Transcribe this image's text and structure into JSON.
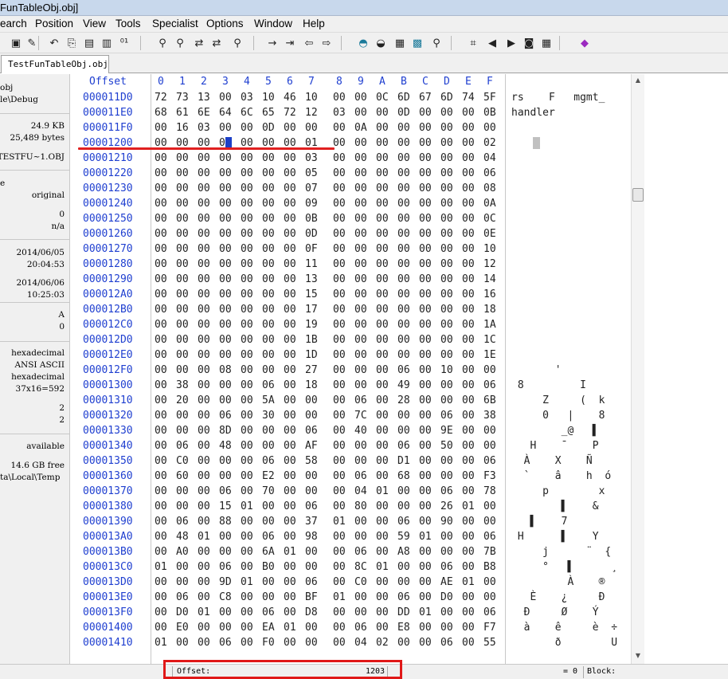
{
  "window": {
    "title": "FunTableObj.obj]"
  },
  "menu": [
    "earch",
    "Position",
    "View",
    "Tools",
    "Specialist",
    "Options",
    "Window",
    "Help"
  ],
  "toolbar_icons": [
    "save-icon",
    "edit-icon",
    "undo-icon",
    "copy-icon",
    "paste-icon",
    "clipboard-icon",
    "binary-icon",
    "find-icon",
    "find-hex-icon",
    "replace-icon",
    "replace-hex-icon",
    "find-text-icon",
    "goto-icon",
    "goto-offset-icon",
    "back-icon",
    "forward-icon",
    "disk-icon",
    "disk-open-icon",
    "ram-icon",
    "calculator-icon",
    "search-icon",
    "block-icon",
    "prev-icon",
    "next-icon",
    "camera-icon",
    "table-icon",
    "book-icon"
  ],
  "tab": {
    "label": "TestFunTableObj.obj"
  },
  "info": {
    "lines": [
      {
        "text": "obj",
        "align": "l"
      },
      {
        "text": "le\\Debug",
        "align": "l"
      },
      {
        "text": "24.9 KB",
        "align": "r"
      },
      {
        "text": "25,489 bytes",
        "align": "r"
      },
      {
        "text": "TESTFU~1.OBJ",
        "align": "r"
      },
      {
        "text": "e",
        "align": "l"
      },
      {
        "text": "original",
        "align": "r"
      },
      {
        "text": "0",
        "align": "r"
      },
      {
        "text": "n/a",
        "align": "r"
      },
      {
        "text": "2014/06/05",
        "align": "r"
      },
      {
        "text": "20:04:53",
        "align": "r"
      },
      {
        "text": "2014/06/06",
        "align": "r"
      },
      {
        "text": "10:25:03",
        "align": "r"
      },
      {
        "text": "A",
        "align": "r"
      },
      {
        "text": "0",
        "align": "r"
      },
      {
        "text": "hexadecimal",
        "align": "r"
      },
      {
        "text": "ANSI ASCII",
        "align": "r"
      },
      {
        "text": "hexadecimal",
        "align": "r"
      },
      {
        "text": "37x16=592",
        "align": "r"
      },
      {
        "text": "2",
        "align": "r"
      },
      {
        "text": "2",
        "align": "r"
      },
      {
        "text": "available",
        "align": "r"
      },
      {
        "text": "14.6 GB free",
        "align": "r"
      },
      {
        "text": "ta\\Local\\Temp",
        "align": "l"
      }
    ]
  },
  "hex": {
    "offset_header": "Offset",
    "column_headers": [
      "0",
      "1",
      "2",
      "3",
      "4",
      "5",
      "6",
      "7",
      "8",
      "9",
      "A",
      "B",
      "C",
      "D",
      "E",
      "F"
    ],
    "cursor": {
      "row": 5,
      "col": 3
    },
    "rows": [
      {
        "offset": "000011D0",
        "bytes": [
          "72",
          "73",
          "13",
          "00",
          "03",
          "10",
          "46",
          "10",
          "00",
          "00",
          "0C",
          "6D",
          "67",
          "6D",
          "74",
          "5F"
        ],
        "text": "rs    F   mgmt_"
      },
      {
        "offset": "000011E0",
        "bytes": [
          "68",
          "61",
          "6E",
          "64",
          "6C",
          "65",
          "72",
          "12",
          "03",
          "00",
          "00",
          "0D",
          "00",
          "00",
          "00",
          "0B"
        ],
        "text": "handler"
      },
      {
        "offset": "000011F0",
        "bytes": [
          "00",
          "16",
          "03",
          "00",
          "00",
          "0D",
          "00",
          "00",
          "00",
          "0A",
          "00",
          "00",
          "00",
          "00",
          "00",
          "00"
        ],
        "text": ""
      },
      {
        "offset": "00001200",
        "bytes": [
          "00",
          "00",
          "00",
          "00",
          "00",
          "00",
          "00",
          "01",
          "00",
          "00",
          "00",
          "00",
          "00",
          "00",
          "00",
          "02"
        ],
        "text": ""
      },
      {
        "offset": "00001210",
        "bytes": [
          "00",
          "00",
          "00",
          "00",
          "00",
          "00",
          "00",
          "03",
          "00",
          "00",
          "00",
          "00",
          "00",
          "00",
          "00",
          "04"
        ],
        "text": ""
      },
      {
        "offset": "00001220",
        "bytes": [
          "00",
          "00",
          "00",
          "00",
          "00",
          "00",
          "00",
          "05",
          "00",
          "00",
          "00",
          "00",
          "00",
          "00",
          "00",
          "06"
        ],
        "text": ""
      },
      {
        "offset": "00001230",
        "bytes": [
          "00",
          "00",
          "00",
          "00",
          "00",
          "00",
          "00",
          "07",
          "00",
          "00",
          "00",
          "00",
          "00",
          "00",
          "00",
          "08"
        ],
        "text": ""
      },
      {
        "offset": "00001240",
        "bytes": [
          "00",
          "00",
          "00",
          "00",
          "00",
          "00",
          "00",
          "09",
          "00",
          "00",
          "00",
          "00",
          "00",
          "00",
          "00",
          "0A"
        ],
        "text": ""
      },
      {
        "offset": "00001250",
        "bytes": [
          "00",
          "00",
          "00",
          "00",
          "00",
          "00",
          "00",
          "0B",
          "00",
          "00",
          "00",
          "00",
          "00",
          "00",
          "00",
          "0C"
        ],
        "text": ""
      },
      {
        "offset": "00001260",
        "bytes": [
          "00",
          "00",
          "00",
          "00",
          "00",
          "00",
          "00",
          "0D",
          "00",
          "00",
          "00",
          "00",
          "00",
          "00",
          "00",
          "0E"
        ],
        "text": ""
      },
      {
        "offset": "00001270",
        "bytes": [
          "00",
          "00",
          "00",
          "00",
          "00",
          "00",
          "00",
          "0F",
          "00",
          "00",
          "00",
          "00",
          "00",
          "00",
          "00",
          "10"
        ],
        "text": ""
      },
      {
        "offset": "00001280",
        "bytes": [
          "00",
          "00",
          "00",
          "00",
          "00",
          "00",
          "00",
          "11",
          "00",
          "00",
          "00",
          "00",
          "00",
          "00",
          "00",
          "12"
        ],
        "text": ""
      },
      {
        "offset": "00001290",
        "bytes": [
          "00",
          "00",
          "00",
          "00",
          "00",
          "00",
          "00",
          "13",
          "00",
          "00",
          "00",
          "00",
          "00",
          "00",
          "00",
          "14"
        ],
        "text": ""
      },
      {
        "offset": "000012A0",
        "bytes": [
          "00",
          "00",
          "00",
          "00",
          "00",
          "00",
          "00",
          "15",
          "00",
          "00",
          "00",
          "00",
          "00",
          "00",
          "00",
          "16"
        ],
        "text": ""
      },
      {
        "offset": "000012B0",
        "bytes": [
          "00",
          "00",
          "00",
          "00",
          "00",
          "00",
          "00",
          "17",
          "00",
          "00",
          "00",
          "00",
          "00",
          "00",
          "00",
          "18"
        ],
        "text": ""
      },
      {
        "offset": "000012C0",
        "bytes": [
          "00",
          "00",
          "00",
          "00",
          "00",
          "00",
          "00",
          "19",
          "00",
          "00",
          "00",
          "00",
          "00",
          "00",
          "00",
          "1A"
        ],
        "text": ""
      },
      {
        "offset": "000012D0",
        "bytes": [
          "00",
          "00",
          "00",
          "00",
          "00",
          "00",
          "00",
          "1B",
          "00",
          "00",
          "00",
          "00",
          "00",
          "00",
          "00",
          "1C"
        ],
        "text": ""
      },
      {
        "offset": "000012E0",
        "bytes": [
          "00",
          "00",
          "00",
          "00",
          "00",
          "00",
          "00",
          "1D",
          "00",
          "00",
          "00",
          "00",
          "00",
          "00",
          "00",
          "1E"
        ],
        "text": ""
      },
      {
        "offset": "000012F0",
        "bytes": [
          "00",
          "00",
          "00",
          "08",
          "00",
          "00",
          "00",
          "27",
          "00",
          "00",
          "00",
          "06",
          "00",
          "10",
          "00",
          "00"
        ],
        "text": "       '"
      },
      {
        "offset": "00001300",
        "bytes": [
          "00",
          "38",
          "00",
          "00",
          "00",
          "06",
          "00",
          "18",
          "00",
          "00",
          "00",
          "49",
          "00",
          "00",
          "00",
          "06"
        ],
        "text": " 8         I"
      },
      {
        "offset": "00001310",
        "bytes": [
          "00",
          "20",
          "00",
          "00",
          "00",
          "5A",
          "00",
          "00",
          "00",
          "06",
          "00",
          "28",
          "00",
          "00",
          "00",
          "6B"
        ],
        "text": "     Z     (  k"
      },
      {
        "offset": "00001320",
        "bytes": [
          "00",
          "00",
          "00",
          "06",
          "00",
          "30",
          "00",
          "00",
          "00",
          "7C",
          "00",
          "00",
          "00",
          "06",
          "00",
          "38"
        ],
        "text": "     0   |    8"
      },
      {
        "offset": "00001330",
        "bytes": [
          "00",
          "00",
          "00",
          "8D",
          "00",
          "00",
          "00",
          "06",
          "00",
          "40",
          "00",
          "00",
          "00",
          "9E",
          "00",
          "00"
        ],
        "text": "        _@   ▌"
      },
      {
        "offset": "00001340",
        "bytes": [
          "00",
          "06",
          "00",
          "48",
          "00",
          "00",
          "00",
          "AF",
          "00",
          "00",
          "00",
          "06",
          "00",
          "50",
          "00",
          "00"
        ],
        "text": "   H    ¯    P"
      },
      {
        "offset": "00001350",
        "bytes": [
          "00",
          "C0",
          "00",
          "00",
          "00",
          "06",
          "00",
          "58",
          "00",
          "00",
          "00",
          "D1",
          "00",
          "00",
          "00",
          "06"
        ],
        "text": "  À    X    Ñ"
      },
      {
        "offset": "00001360",
        "bytes": [
          "00",
          "60",
          "00",
          "00",
          "00",
          "E2",
          "00",
          "00",
          "00",
          "06",
          "00",
          "68",
          "00",
          "00",
          "00",
          "F3"
        ],
        "text": "  `    â    h  ó"
      },
      {
        "offset": "00001370",
        "bytes": [
          "00",
          "00",
          "00",
          "06",
          "00",
          "70",
          "00",
          "00",
          "00",
          "04",
          "01",
          "00",
          "00",
          "06",
          "00",
          "78"
        ],
        "text": "     p        x"
      },
      {
        "offset": "00001380",
        "bytes": [
          "00",
          "00",
          "00",
          "15",
          "01",
          "00",
          "00",
          "06",
          "00",
          "80",
          "00",
          "00",
          "00",
          "26",
          "01",
          "00"
        ],
        "text": "        ▌    &"
      },
      {
        "offset": "00001390",
        "bytes": [
          "00",
          "06",
          "00",
          "88",
          "00",
          "00",
          "00",
          "37",
          "01",
          "00",
          "00",
          "06",
          "00",
          "90",
          "00",
          "00"
        ],
        "text": "   ▌    7"
      },
      {
        "offset": "000013A0",
        "bytes": [
          "00",
          "48",
          "01",
          "00",
          "00",
          "06",
          "00",
          "98",
          "00",
          "00",
          "00",
          "59",
          "01",
          "00",
          "00",
          "06"
        ],
        "text": " H      ▌    Y"
      },
      {
        "offset": "000013B0",
        "bytes": [
          "00",
          "A0",
          "00",
          "00",
          "00",
          "6A",
          "01",
          "00",
          "00",
          "06",
          "00",
          "A8",
          "00",
          "00",
          "00",
          "7B"
        ],
        "text": "     j      ¨  {"
      },
      {
        "offset": "000013C0",
        "bytes": [
          "01",
          "00",
          "00",
          "06",
          "00",
          "B0",
          "00",
          "00",
          "00",
          "8C",
          "01",
          "00",
          "00",
          "06",
          "00",
          "B8"
        ],
        "text": "     °   ▌      ¸"
      },
      {
        "offset": "000013D0",
        "bytes": [
          "00",
          "00",
          "00",
          "9D",
          "01",
          "00",
          "00",
          "06",
          "00",
          "C0",
          "00",
          "00",
          "00",
          "AE",
          "01",
          "00"
        ],
        "text": "         À    ®"
      },
      {
        "offset": "000013E0",
        "bytes": [
          "00",
          "06",
          "00",
          "C8",
          "00",
          "00",
          "00",
          "BF",
          "01",
          "00",
          "00",
          "06",
          "00",
          "D0",
          "00",
          "00"
        ],
        "text": "   È    ¿     Ð"
      },
      {
        "offset": "000013F0",
        "bytes": [
          "00",
          "D0",
          "01",
          "00",
          "00",
          "06",
          "00",
          "D8",
          "00",
          "00",
          "00",
          "DD",
          "01",
          "00",
          "00",
          "06"
        ],
        "text": "  Ð     Ø    Ý"
      },
      {
        "offset": "00001400",
        "bytes": [
          "00",
          "E0",
          "00",
          "00",
          "00",
          "EA",
          "01",
          "00",
          "00",
          "06",
          "00",
          "E8",
          "00",
          "00",
          "00",
          "F7"
        ],
        "text": "  à    ê     è  ÷"
      },
      {
        "offset": "00001410",
        "bytes": [
          "01",
          "00",
          "00",
          "06",
          "00",
          "F0",
          "00",
          "00",
          "00",
          "04",
          "02",
          "00",
          "00",
          "06",
          "00",
          "55"
        ],
        "text": "       ð        U"
      }
    ]
  },
  "status": {
    "offset_label": "Offset:",
    "offset_value": "1203",
    "eq_value": "= 0",
    "block_label": "Block:"
  }
}
